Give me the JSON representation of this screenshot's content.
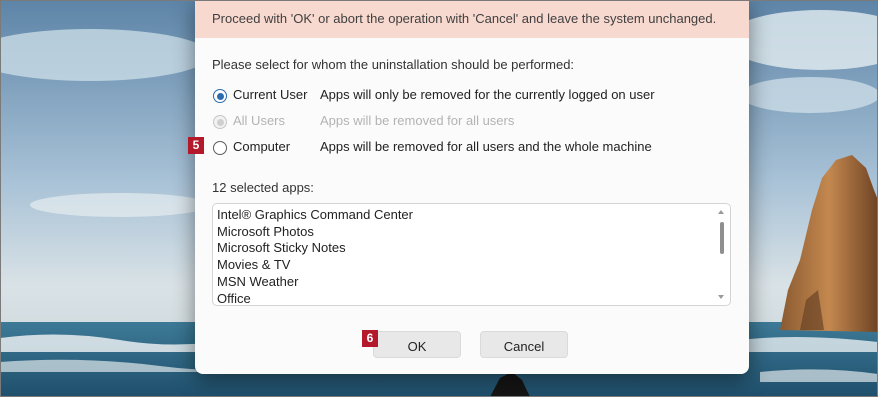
{
  "dialog": {
    "warning_text": "Proceed with 'OK' or abort the operation with 'Cancel' and leave the system unchanged.",
    "prompt": "Please select for whom the uninstallation should be performed:",
    "options": [
      {
        "label": "Current User",
        "description": "Apps will only be removed for the currently logged on user",
        "state": "selected"
      },
      {
        "label": "All Users",
        "description": "Apps will be removed for all users",
        "state": "disabled"
      },
      {
        "label": "Computer",
        "description": "Apps will be removed for all users and the whole machine",
        "state": "unselected"
      }
    ],
    "selected_count_label": "12 selected apps:",
    "apps": [
      "Intel® Graphics Command Center",
      "Microsoft Photos",
      "Microsoft Sticky Notes",
      "Movies & TV",
      "MSN Weather",
      "Office"
    ],
    "ok_label": "OK",
    "cancel_label": "Cancel"
  },
  "markers": {
    "computer_option": "5",
    "ok_button": "6"
  },
  "colors": {
    "warning_background": "#f8d9cf",
    "radio_selected": "#2b6cb0",
    "marker": "#b3182b"
  }
}
